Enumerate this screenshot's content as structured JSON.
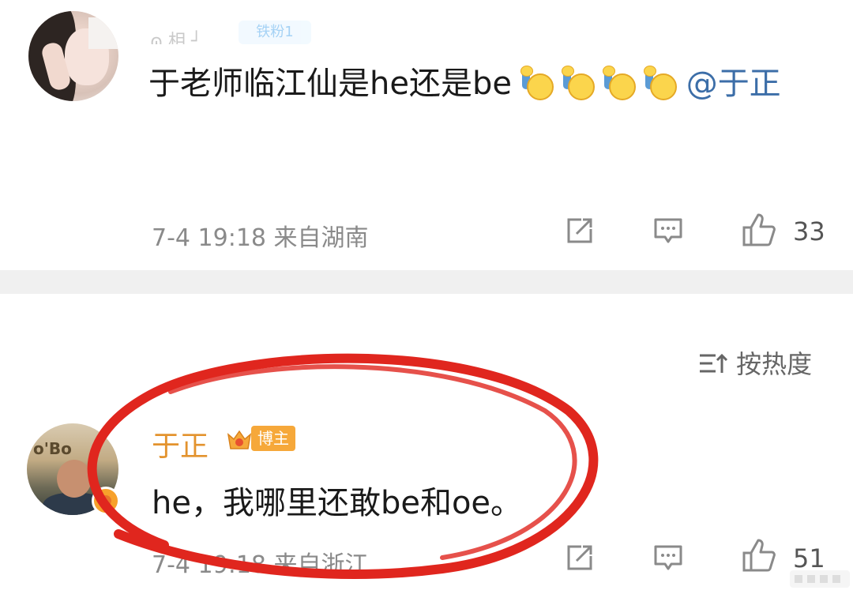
{
  "post1": {
    "avatar_desc": "avatar",
    "username": "ɷ 相 ┘",
    "badge": "铁粉1",
    "text": "于老师临江仙是he还是be",
    "emojis": [
      "raise-hand-emoji",
      "raise-hand-emoji",
      "raise-hand-emoji",
      "raise-hand-emoji"
    ],
    "mention": "@于正",
    "time": "7-4 19:18",
    "location": "来自湖南",
    "like_count": "33"
  },
  "sort_label": "按热度",
  "post2": {
    "username": "于正",
    "badge": "博主",
    "text": "he，我哪里还敢be和oe。",
    "time": "7-4 19:18",
    "location": "来自浙江",
    "like_count": "51",
    "avatar_sign": "o'Bo"
  },
  "colors": {
    "accent_orange": "#e3932e",
    "mention_blue": "#3c6ea8",
    "annotation_red": "#e0261e",
    "divider": "#f0f0f0"
  },
  "icons": [
    "share-icon",
    "comment-icon",
    "like-icon",
    "sort-icon",
    "crown-icon"
  ]
}
